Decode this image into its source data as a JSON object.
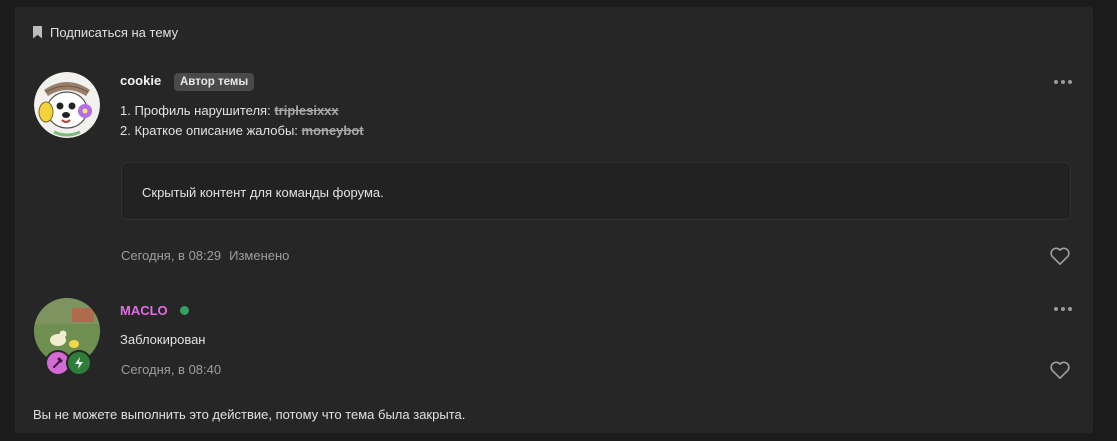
{
  "subscribe": {
    "label": "Подписаться на тему",
    "icon": "bookmark-icon"
  },
  "posts": [
    {
      "author": "cookie",
      "author_color": "#f2f2f2",
      "badge": "Автор темы",
      "lines": [
        {
          "prefix": "1. Профиль нарушителя: ",
          "value": "triplesixxx"
        },
        {
          "prefix": "2. Краткое описание жалобы: ",
          "value": "moneybot"
        }
      ],
      "hidden_content": "Скрытый контент для команды форума.",
      "time": "Сегодня, в 08:29",
      "edited": "Изменено"
    },
    {
      "author": "MACLO",
      "author_color": "#e36be3",
      "online": true,
      "content": "Заблокирован",
      "time": "Сегодня, в 08:40"
    }
  ],
  "footer_note": "Вы не можете выполнить это действие, потому что тема была закрыта.",
  "colors": {
    "panel": "#262626",
    "online": "#33a060",
    "badge_pink": "#d46bd4",
    "badge_green": "#2e7d3a"
  }
}
